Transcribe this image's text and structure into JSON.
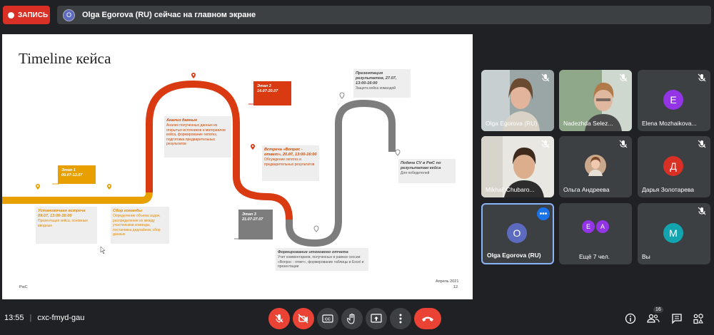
{
  "top": {
    "record_label": "ЗАПИСЬ",
    "presenter_initial": "O",
    "presenter_text": "Olga Egorova (RU) сейчас на главном экране"
  },
  "slide": {
    "title": "Timeline кейса",
    "footer_left": "PwC",
    "footer_right": "Апрель 2021",
    "page": "12",
    "stages": [
      {
        "name": "Этап 1",
        "dates": "09.07-13.07"
      },
      {
        "name": "Этап 2",
        "dates": "14.07-20.07"
      },
      {
        "name": "Этап 3",
        "dates": "21.07-27.07"
      }
    ],
    "events": {
      "kickoff": {
        "title": "Установочная встреча 09.07, 13:00-16:00",
        "text": "Презентация кейса, основные вводные"
      },
      "team": {
        "title": "Сбор команды",
        "text": "Определение объема задач, распределение их между участниками команды, постановка дедлайнов, сбор данных"
      },
      "analysis": {
        "title": "Анализ данных",
        "text": "Анализ полученных данных из открытых источников и материалов кейса, формирование гипотез, подготовка предварительных результатов"
      },
      "qa": {
        "title": "Встреча «Вопрос - ответ», 20.07, 13:00-16:00",
        "text": "Обсуждение гипотез и предварительных результатов"
      },
      "report": {
        "title": "Формирование итогового отчета",
        "text": "Учет комментариев, полученных в рамках сессии «Вопрос - ответ», формирование таблицы в Excel и презентации"
      },
      "presentation": {
        "title": "Презентация результатов, 27.07, 13:00-16:00",
        "text": "Защита кейса командой"
      },
      "cv": {
        "title": "Подача CV в PwC по результатам кейса",
        "text": "Для победителей"
      }
    }
  },
  "participants": [
    {
      "name": "Olga Egorova (RU)",
      "type": "video",
      "muted": true
    },
    {
      "name": "Nadezhda Selez...",
      "type": "video",
      "muted": true
    },
    {
      "name": "Elena Mozhaikova...",
      "type": "avatar",
      "initial": "E",
      "color": "#9334e6",
      "muted": true
    },
    {
      "name": "Mikhail Chubaro...",
      "type": "video",
      "muted": true
    },
    {
      "name": "Ольга Андреева",
      "type": "photo",
      "muted": true
    },
    {
      "name": "Дарья Золотарева",
      "type": "avatar",
      "initial": "Д",
      "color": "#d93025",
      "muted": true
    },
    {
      "name": "Olga Egorova (RU)",
      "type": "avatar",
      "initial": "O",
      "color": "#5c6bc0",
      "muted": false
    },
    {
      "name": "Ещё 7 чел.",
      "type": "group",
      "initials": [
        "E",
        "A"
      ]
    },
    {
      "name": "Вы",
      "type": "avatar",
      "initial": "М",
      "color": "#12a4af",
      "muted": true
    }
  ],
  "bottom": {
    "time": "13:55",
    "separator": "|",
    "meeting_code": "cxc-fmyd-gau",
    "people_count": "16"
  },
  "colors": {
    "orange": "#e8a000",
    "red": "#d93a12",
    "gray": "#7d7d7d",
    "hangup": "#ea4335"
  }
}
